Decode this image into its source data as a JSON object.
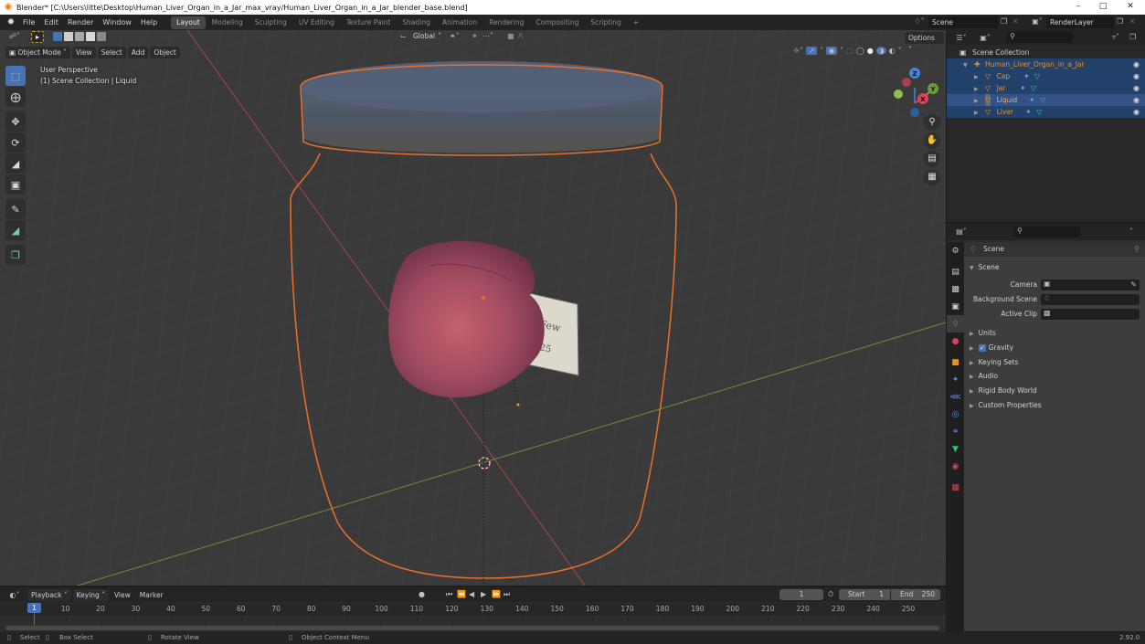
{
  "window": {
    "title": "Blender* [C:\\Users\\litte\\Desktop\\Human_Liver_Organ_in_a_Jar_max_vray/Human_Liver_Organ_in_a_Jar_blender_base.blend]",
    "minimize": "–",
    "maximize": "□",
    "close": "✕"
  },
  "menubar": {
    "menus": [
      "File",
      "Edit",
      "Render",
      "Window",
      "Help"
    ],
    "workspaces": [
      "Layout",
      "Modeling",
      "Sculpting",
      "UV Editing",
      "Texture Paint",
      "Shading",
      "Animation",
      "Rendering",
      "Compositing",
      "Scripting"
    ],
    "active_workspace": "Layout",
    "add_workspace": "+",
    "scene": "Scene",
    "view_layer": "RenderLayer"
  },
  "viewport": {
    "mode": "Object Mode",
    "menus": [
      "View",
      "Select",
      "Add",
      "Object"
    ],
    "transform_orientation": "Global",
    "options_label": "Options",
    "view_name": "User Perspective",
    "collection_info": "(1) Scene Collection | Liquid",
    "tools": [
      "select-box",
      "cursor",
      "move",
      "rotate",
      "scale",
      "transform",
      "annotate",
      "measure",
      "add-cube"
    ],
    "active_tool": "select-box",
    "gizmo_axes": [
      "Z",
      "Y",
      "X"
    ],
    "label_text_fragments": [
      "Few",
      "25"
    ]
  },
  "outliner": {
    "search_placeholder": "",
    "root": "Scene Collection",
    "collection": "Human_Liver_Organ_in_a_Jar",
    "objects": [
      {
        "name": "Cap",
        "active": false
      },
      {
        "name": "Jar",
        "active": false
      },
      {
        "name": "Liquid",
        "active": true
      },
      {
        "name": "Liver",
        "active": false
      }
    ]
  },
  "properties": {
    "search_placeholder": "",
    "context": "Scene",
    "panel_title": "Scene",
    "fields": [
      {
        "label": "Camera",
        "value": ""
      },
      {
        "label": "Background Scene",
        "value": ""
      },
      {
        "label": "Active Clip",
        "value": ""
      }
    ],
    "subpanels": [
      {
        "label": "Units",
        "checkbox": null
      },
      {
        "label": "Gravity",
        "checkbox": true
      },
      {
        "label": "Keying Sets",
        "checkbox": null
      },
      {
        "label": "Audio",
        "checkbox": null
      },
      {
        "label": "Rigid Body World",
        "checkbox": null
      },
      {
        "label": "Custom Properties",
        "checkbox": null
      }
    ],
    "tabs": [
      "tool",
      "render",
      "output",
      "view-layer",
      "scene",
      "world",
      "object",
      "modifiers",
      "particles",
      "physics",
      "constraints",
      "data",
      "material",
      "texture"
    ],
    "active_tab": "scene"
  },
  "timeline": {
    "menus": [
      "Playback",
      "Keying",
      "View",
      "Marker"
    ],
    "current_frame": "1",
    "start_label": "Start",
    "start": "1",
    "end_label": "End",
    "end": "250",
    "ruler": [
      "10",
      "20",
      "30",
      "40",
      "50",
      "60",
      "70",
      "80",
      "90",
      "100",
      "110",
      "120",
      "130",
      "140",
      "150",
      "160",
      "170",
      "180",
      "190",
      "200",
      "210",
      "220",
      "230",
      "240",
      "250"
    ],
    "playhead": "1"
  },
  "statusbar": {
    "select": "Select",
    "box_select": "Box Select",
    "rotate_view": "Rotate View",
    "context_menu": "Object Context Menu",
    "version": "2.92.0"
  },
  "colors": {
    "accent_blue": "#4772b3",
    "selection_outline": "#e8702a",
    "active_object_text": "#f0a060",
    "x_axis": "#e0405a",
    "y_axis": "#8bc34a",
    "z_axis": "#3d85e0"
  }
}
